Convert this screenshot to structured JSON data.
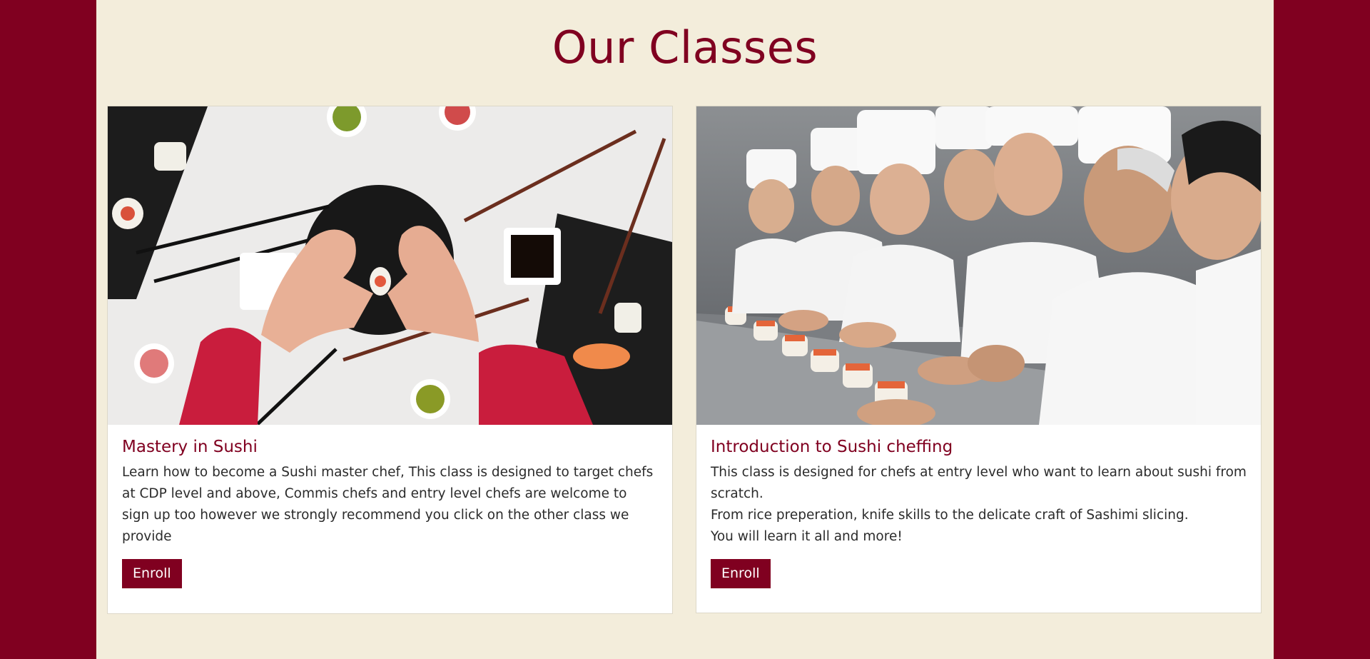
{
  "section": {
    "title": "Our Classes"
  },
  "classes": [
    {
      "title": "Mastery in Sushi",
      "description": "Learn how to become a Sushi master chef, This class is designed to target chefs at CDP level and above, Commis chefs and entry level chefs are welcome to sign up too however we strongly recommend you click on the other class we provide",
      "button_label": "Enroll",
      "image_subject": "hands-heart-sushi-platter"
    },
    {
      "title": "Introduction to Sushi cheffing",
      "description": "This class is designed for chefs at entry level who want to learn about sushi from scratch.\nFrom rice preperation, knife skills to the delicate craft of Sashimi slicing.\nYou will learn it all and more!",
      "button_label": "Enroll",
      "image_subject": "chefs-rolling-sushi-class"
    }
  ],
  "colors": {
    "brand": "#800020",
    "background": "#f3eddb",
    "card": "#ffffff",
    "text": "#2b2b2b"
  }
}
